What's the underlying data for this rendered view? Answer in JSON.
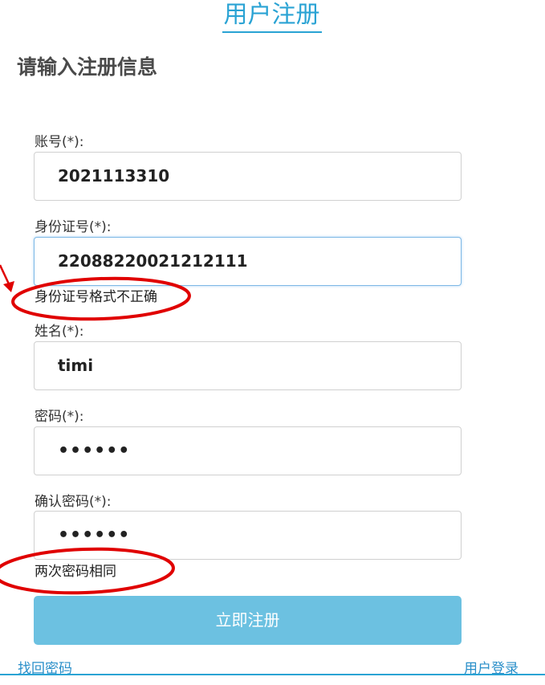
{
  "header": {
    "title": "用户注册",
    "section_heading": "请输入注册信息"
  },
  "form": {
    "account": {
      "label": "账号(*):",
      "value": "2021113310"
    },
    "id_number": {
      "label": "身份证号(*):",
      "value": "22088220021212111",
      "hint": "身份证号格式不正确"
    },
    "name": {
      "label": "姓名(*):",
      "value": "timi"
    },
    "password": {
      "label": "密码(*):",
      "value": "••••••"
    },
    "confirm_password": {
      "label": "确认密码(*):",
      "value": "••••••",
      "hint": "两次密码相同"
    },
    "submit_label": "立即注册"
  },
  "footer": {
    "forgot_password": "找回密码",
    "user_login": "用户登录"
  },
  "colors": {
    "accent": "#2aa3d4",
    "button": "#6cc1e1",
    "annotation": "#e00000"
  }
}
